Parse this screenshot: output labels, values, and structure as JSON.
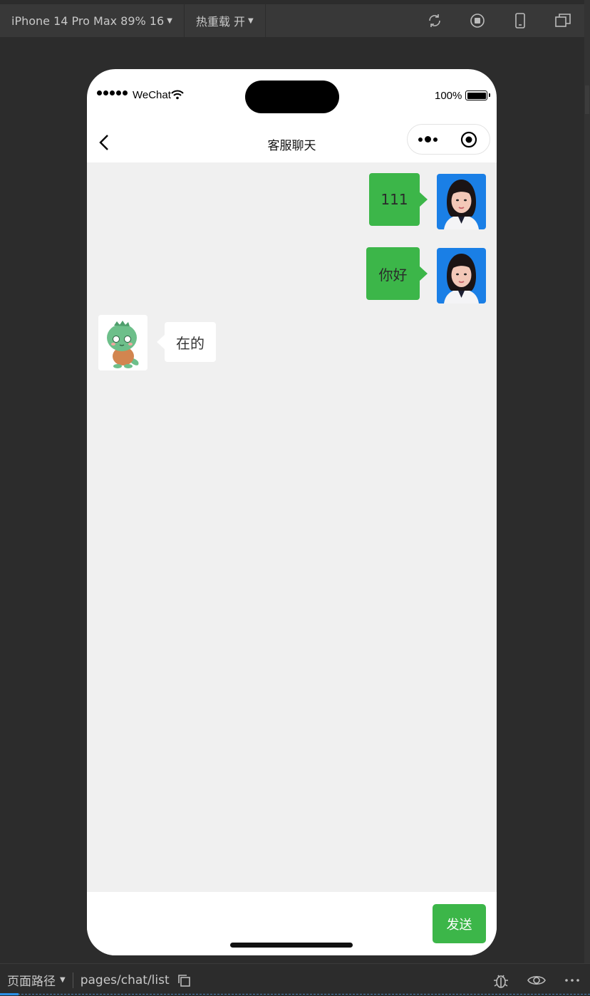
{
  "toolbar": {
    "device_label": "iPhone 14 Pro Max 89% 16",
    "hot_reload_label": "热重载 开",
    "icons": [
      "refresh-icon",
      "stop-icon",
      "phone-icon",
      "window-icon"
    ]
  },
  "status_bar": {
    "carrier": "WeChat",
    "battery": "100%"
  },
  "nav": {
    "title": "客服聊天"
  },
  "messages": [
    {
      "side": "right",
      "text": "111",
      "avatar": "user-photo"
    },
    {
      "side": "right",
      "text": "你好",
      "avatar": "user-photo"
    },
    {
      "side": "left",
      "text": "在的",
      "avatar": "dino-mascot"
    }
  ],
  "input": {
    "value": "",
    "send_label": "发送"
  },
  "bottom_bar": {
    "path_label": "页面路径",
    "path": "pages/chat/list"
  },
  "colors": {
    "accent_green": "#3cb649",
    "chat_bg": "#f0f0f0",
    "ide_bg": "#2c2c2c"
  }
}
